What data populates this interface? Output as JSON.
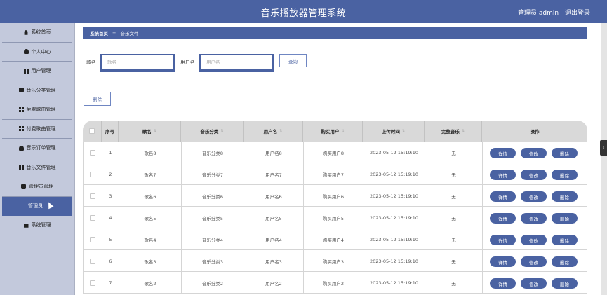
{
  "app": {
    "title": "音乐播放器管理系统",
    "user_text": "管理员 admin",
    "logout": "退出登录"
  },
  "sidebar": {
    "items": [
      {
        "label": "系统首页",
        "icon": "home-icon"
      },
      {
        "label": "个人中心",
        "icon": "person-icon"
      },
      {
        "label": "用户管理",
        "icon": "grid-icon"
      },
      {
        "label": "音乐分类管理",
        "icon": "clipboard-icon"
      },
      {
        "label": "免费歌曲管理",
        "icon": "film-icon"
      },
      {
        "label": "付费歌曲管理",
        "icon": "grid-icon"
      },
      {
        "label": "音乐订单管理",
        "icon": "person-icon"
      },
      {
        "label": "音乐文件管理",
        "icon": "list-icon"
      },
      {
        "label": "管理员管理",
        "icon": "bag-icon"
      },
      {
        "label": "管理员",
        "icon": ""
      },
      {
        "label": "系统管理",
        "icon": "briefcase-icon"
      }
    ],
    "active_index": 9
  },
  "breadcrumb": {
    "home": "系统首页",
    "separator": "≡",
    "current": "音乐文件"
  },
  "search": {
    "song_label": "歌名",
    "song_placeholder": "歌名",
    "user_label": "用户名",
    "user_placeholder": "用户名",
    "query_button": "查询"
  },
  "toolbar": {
    "delete_button": "删除"
  },
  "table": {
    "columns": [
      "",
      "序号",
      "歌名",
      "音乐分类",
      "用户名",
      "购买用户",
      "上传时间",
      "完整音乐",
      "操作"
    ],
    "sortable": [
      false,
      false,
      true,
      true,
      true,
      true,
      true,
      true,
      false
    ],
    "actions": {
      "detail": "详情",
      "edit": "修改",
      "delete": "删除"
    },
    "rows": [
      {
        "index": "1",
        "song": "歌名8",
        "category": "音乐分类8",
        "user": "用户名8",
        "buyer": "购买用户8",
        "time": "2023-05-12 15:19:10",
        "full": "无"
      },
      {
        "index": "2",
        "song": "歌名7",
        "category": "音乐分类7",
        "user": "用户名7",
        "buyer": "购买用户7",
        "time": "2023-05-12 15:19:10",
        "full": "无"
      },
      {
        "index": "3",
        "song": "歌名6",
        "category": "音乐分类6",
        "user": "用户名6",
        "buyer": "购买用户6",
        "time": "2023-05-12 15:19:10",
        "full": "无"
      },
      {
        "index": "4",
        "song": "歌名5",
        "category": "音乐分类5",
        "user": "用户名5",
        "buyer": "购买用户5",
        "time": "2023-05-12 15:19:10",
        "full": "无"
      },
      {
        "index": "5",
        "song": "歌名4",
        "category": "音乐分类4",
        "user": "用户名4",
        "buyer": "购买用户4",
        "time": "2023-05-12 15:19:10",
        "full": "无"
      },
      {
        "index": "6",
        "song": "歌名3",
        "category": "音乐分类3",
        "user": "用户名3",
        "buyer": "购买用户3",
        "time": "2023-05-12 15:19:10",
        "full": "无"
      },
      {
        "index": "7",
        "song": "歌名2",
        "category": "音乐分类2",
        "user": "用户名2",
        "buyer": "购买用户2",
        "time": "2023-05-12 15:19:10",
        "full": "无"
      }
    ]
  },
  "colors": {
    "primary": "#4a62a2",
    "sidebar_bg": "#c3c9dc",
    "header_bg": "#d9d9d9"
  }
}
